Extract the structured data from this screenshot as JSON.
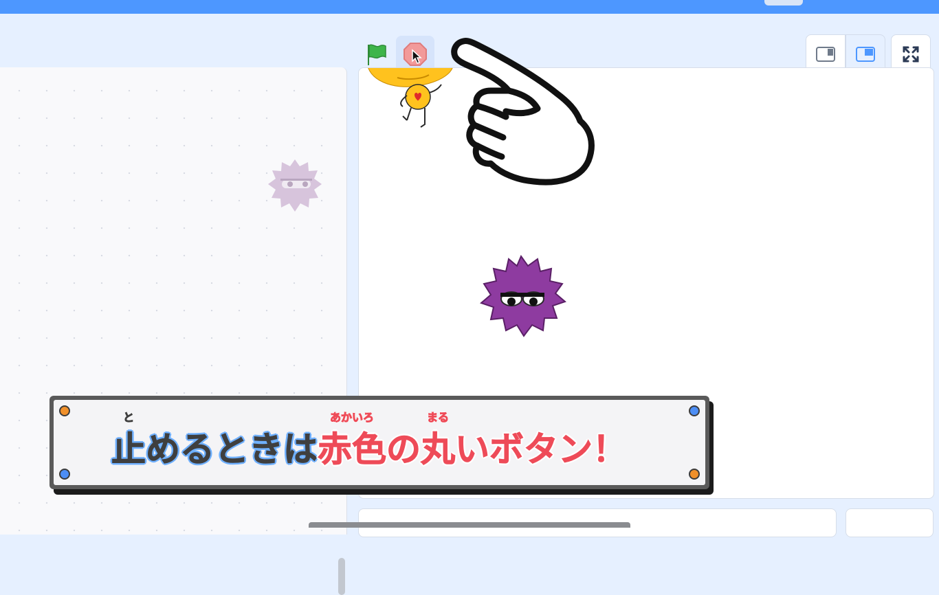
{
  "toolbar": {
    "green_flag_icon": "green-flag-icon",
    "stop_icon": "stop-sign-icon",
    "layout_buttons": [
      "small-stage",
      "normal-stage",
      "fullscreen"
    ]
  },
  "caption": {
    "segments": [
      {
        "text": "止",
        "ruby": "と",
        "style": "dark"
      },
      {
        "text": "めるときは",
        "ruby": "",
        "style": "dark"
      },
      {
        "text": "赤色",
        "ruby": "あかいろ",
        "style": "red"
      },
      {
        "text": "の",
        "ruby": "",
        "style": "red"
      },
      {
        "text": "丸",
        "ruby": "まる",
        "style": "red"
      },
      {
        "text": "いボタン！",
        "ruby": "",
        "style": "red"
      }
    ]
  },
  "colors": {
    "topbar": "#4d97ff",
    "toolbar_bg": "#e6f0ff",
    "caption_dark": "#3f3f3f",
    "caption_red": "#ee4b58",
    "caption_outline_blue": "#6fb0ff",
    "sprite_purple": "#8e3ba0",
    "sprite_yellow": "#ffc21e",
    "stop_red": "#f29a9a",
    "flag_green": "#3eb54a"
  }
}
